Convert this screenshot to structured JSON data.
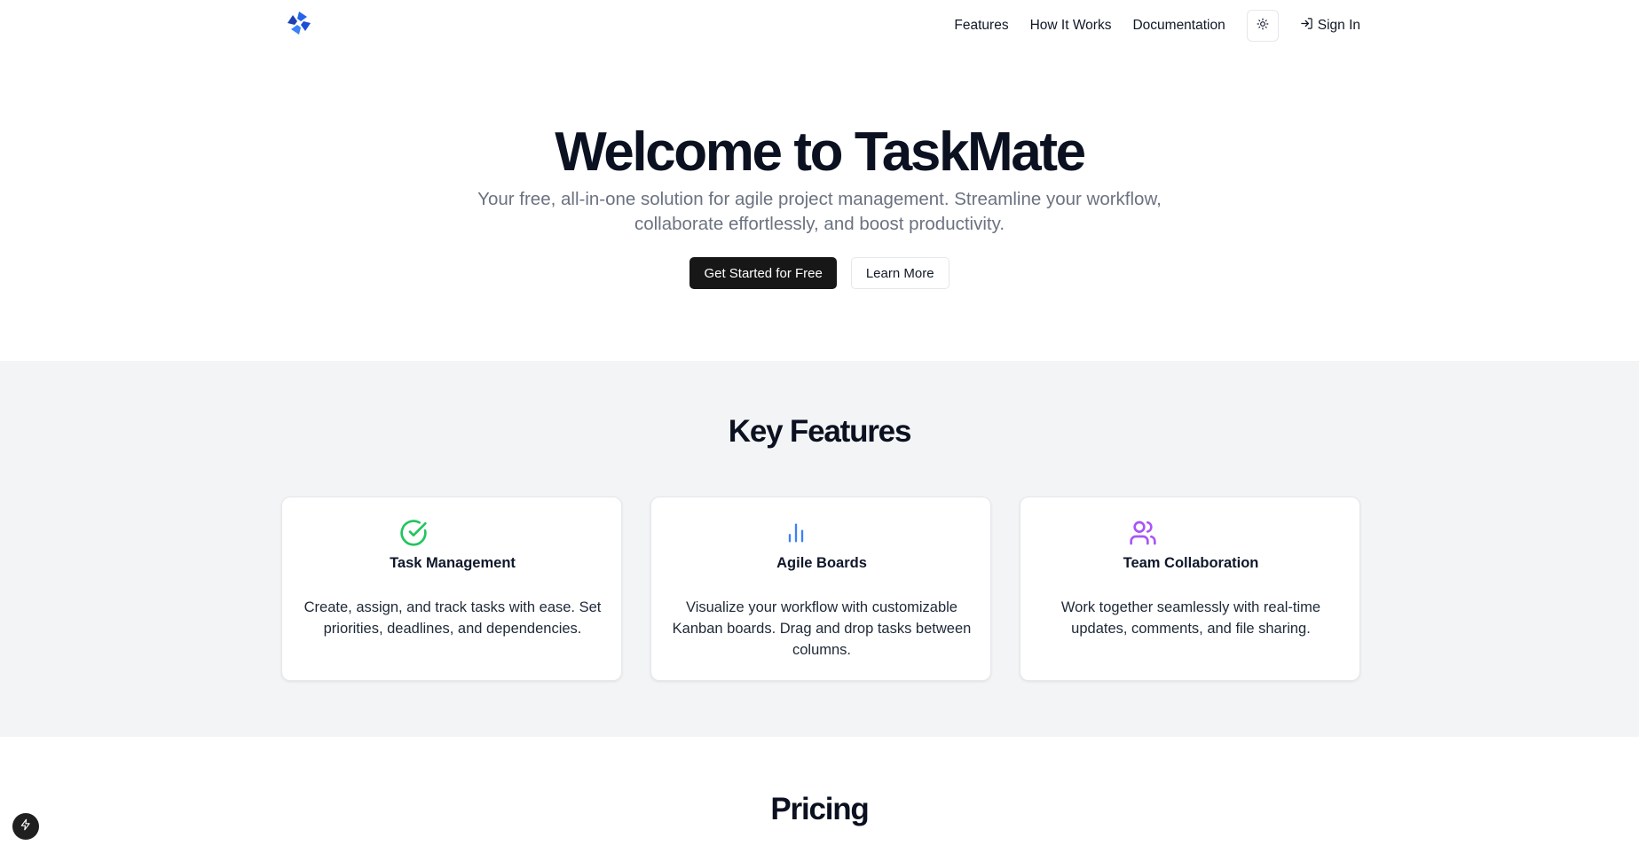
{
  "header": {
    "logo_icon": "taskmate-logo-icon",
    "nav": [
      {
        "label": "Features"
      },
      {
        "label": "How It Works"
      },
      {
        "label": "Documentation"
      }
    ],
    "theme_icon": "sun-icon",
    "signin_label": "Sign In",
    "signin_icon": "sign-in-icon"
  },
  "hero": {
    "title": "Welcome to TaskMate",
    "subtitle_line1": "Your free, all-in-one solution for agile project management. Streamline your workflow,",
    "subtitle_line2": "collaborate effortlessly, and boost productivity.",
    "primary_button": "Get Started for Free",
    "secondary_button": "Learn More"
  },
  "features": {
    "title": "Key Features",
    "cards": [
      {
        "icon": "check-circle-icon",
        "icon_color": "#22c55e",
        "title": "Task Management",
        "desc": "Create, assign, and track tasks with ease. Set priorities, deadlines, and dependencies."
      },
      {
        "icon": "bar-chart-icon",
        "icon_color": "#3b82f6",
        "title": "Agile Boards",
        "desc": "Visualize your workflow with customizable Kanban boards. Drag and drop tasks between columns."
      },
      {
        "icon": "users-icon",
        "icon_color": "#a855f7",
        "title": "Team Collaboration",
        "desc": "Work together seamlessly with real-time updates, comments, and file sharing."
      }
    ]
  },
  "pricing": {
    "title": "Pricing"
  },
  "floating_badge_icon": "lightning-icon"
}
